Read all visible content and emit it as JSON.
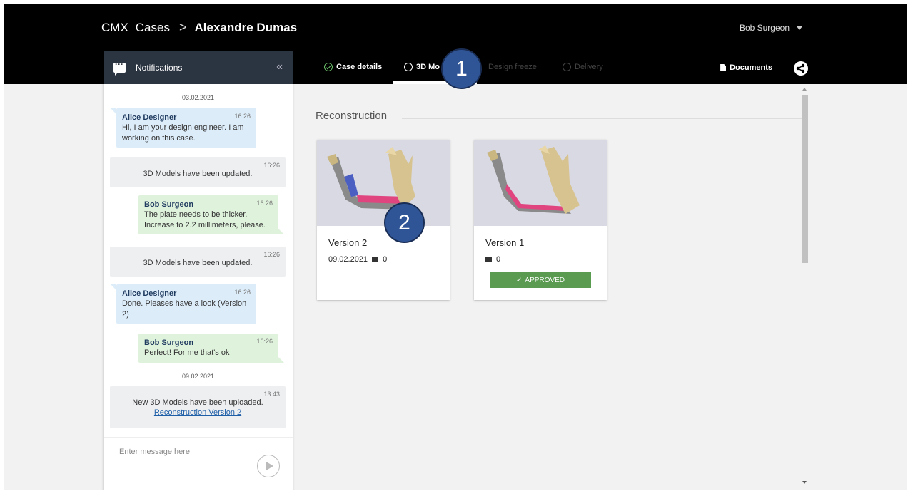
{
  "breadcrumb": {
    "app": "CMX",
    "section": "Cases",
    "separator": ">",
    "current": "Alexandre Dumas"
  },
  "user": {
    "name": "Bob Surgeon"
  },
  "tabs": [
    {
      "label": "Case details",
      "state": "done"
    },
    {
      "label": "3D Mo",
      "state": "active"
    },
    {
      "label": "Design freeze",
      "state": "disabled"
    },
    {
      "label": "Delivery",
      "state": "disabled"
    }
  ],
  "toolbar": {
    "documents_label": "Documents"
  },
  "notifications": {
    "title": "Notifications",
    "collapse_glyph": "«",
    "date1": "03.02.2021",
    "date2": "09.02.2021",
    "messages": [
      {
        "type": "alice",
        "author": "Alice Designer",
        "time": "16:26",
        "text": "Hi, I am your design engineer. I am working on this case."
      },
      {
        "type": "sys",
        "time": "16:26",
        "text": "3D Models have been updated."
      },
      {
        "type": "bob",
        "author": "Bob Surgeon",
        "time": "16:26",
        "text": "The plate needs to be thicker. Increase to 2.2 millimeters, please."
      },
      {
        "type": "sys",
        "time": "16:26",
        "text": "3D Models have been updated."
      },
      {
        "type": "alice",
        "author": "Alice Designer",
        "time": "16:26",
        "text": "Done. Pleases have a look (Version 2)"
      },
      {
        "type": "bob",
        "author": "Bob Surgeon",
        "time": "16:26",
        "text": "Perfect! For me that's ok"
      },
      {
        "type": "sys",
        "time": "13:43",
        "text": "New 3D Models have been uploaded.",
        "link": "Reconstruction Version 2"
      }
    ],
    "input_placeholder": "Enter message here"
  },
  "main": {
    "section_title": "Reconstruction",
    "cards": [
      {
        "version": "Version 2",
        "date": "09.02.2021",
        "comments": "0"
      },
      {
        "version": "Version 1",
        "date": "",
        "comments": "0",
        "status": "APPROVED"
      }
    ]
  },
  "callouts": [
    "1",
    "2"
  ],
  "colors": {
    "topbar": "#000000",
    "notif_header": "#2b3441",
    "alice_bubble": "#dcecf9",
    "bob_bubble": "#dff2dc",
    "approved": "#5b9a51",
    "callout": "#2f5597"
  }
}
